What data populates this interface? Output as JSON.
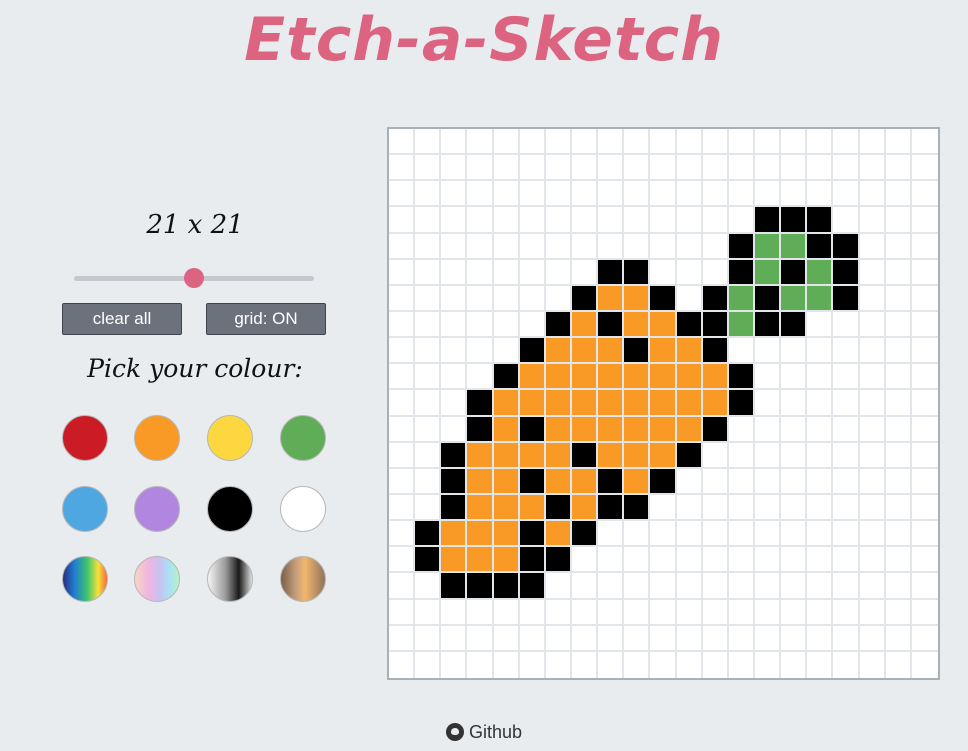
{
  "title": "Etch-a-Sketch",
  "size_label": "21 x 21",
  "grid_size": 21,
  "slider": {
    "value": 21,
    "min": 1,
    "max": 41
  },
  "buttons": {
    "clear": "clear all",
    "grid": "grid: ON"
  },
  "pick_label": "Pick your colour:",
  "colors": {
    "title": "#dd6480",
    "accent": "#dd6480",
    "button_bg": "#6c727c",
    "grid_line": "#e2e5e9",
    "board_border": "#a8b0b8",
    "palette": {
      "K": "#000000",
      "O": "#f99a26",
      "G": "#5fad56"
    }
  },
  "swatches": [
    {
      "name": "red-swatch",
      "fill": "#cb1b24"
    },
    {
      "name": "orange-swatch",
      "fill": "#f99a26"
    },
    {
      "name": "yellow-swatch",
      "fill": "#fcd740"
    },
    {
      "name": "green-swatch",
      "fill": "#5fad56"
    },
    {
      "name": "blue-swatch",
      "fill": "#4ea7e1"
    },
    {
      "name": "purple-swatch",
      "fill": "#b186e0"
    },
    {
      "name": "black-swatch",
      "fill": "#000000"
    },
    {
      "name": "white-swatch",
      "fill": "#ffffff"
    },
    {
      "name": "rainbow-swatch",
      "fill": "linear-gradient(90deg,#2b2d7c 0%,#1f7bd3 25%,#3ec46d 55%,#f7e13a 80%,#f36b3b 100%)"
    },
    {
      "name": "pastel-swatch",
      "fill": "linear-gradient(90deg,#f7d6c2 0%,#f2b5e0 30%,#c9c0f3 55%,#a8e3f1 80%,#b8f2c2 100%)"
    },
    {
      "name": "grey-gradient-swatch",
      "fill": "linear-gradient(90deg,#f4f4f4 0%,#9a9a9a 40%,#1a1a1a 70%,#e0e0e0 100%)"
    },
    {
      "name": "bronze-swatch",
      "fill": "linear-gradient(90deg,#7a5f4a 0%,#c9a07d 35%,#f1b66b 55%,#8e735e 100%)"
    }
  ],
  "pixels": [
    ".....................",
    ".....................",
    ".....................",
    "..............KKK....",
    ".............KGGKK...",
    "........KK...KGKGK...",
    ".......KOOK.KGKGGK...",
    "......KOKOOKKGKK.....",
    ".....KOOOKOOK........",
    "....KOOOOOOOOK.......",
    "...KOOOOOOOOOK.......",
    "...KOKOOOOOOK........",
    "..KOOOOKOOOK.........",
    "..KOOKOOKOK..........",
    "..KOOOKOKK...........",
    ".KOOOKOK.............",
    ".KOOOKK..............",
    "..KKKK...............",
    ".....................",
    ".....................",
    "....................."
  ],
  "footer": {
    "link_label": "Github"
  }
}
